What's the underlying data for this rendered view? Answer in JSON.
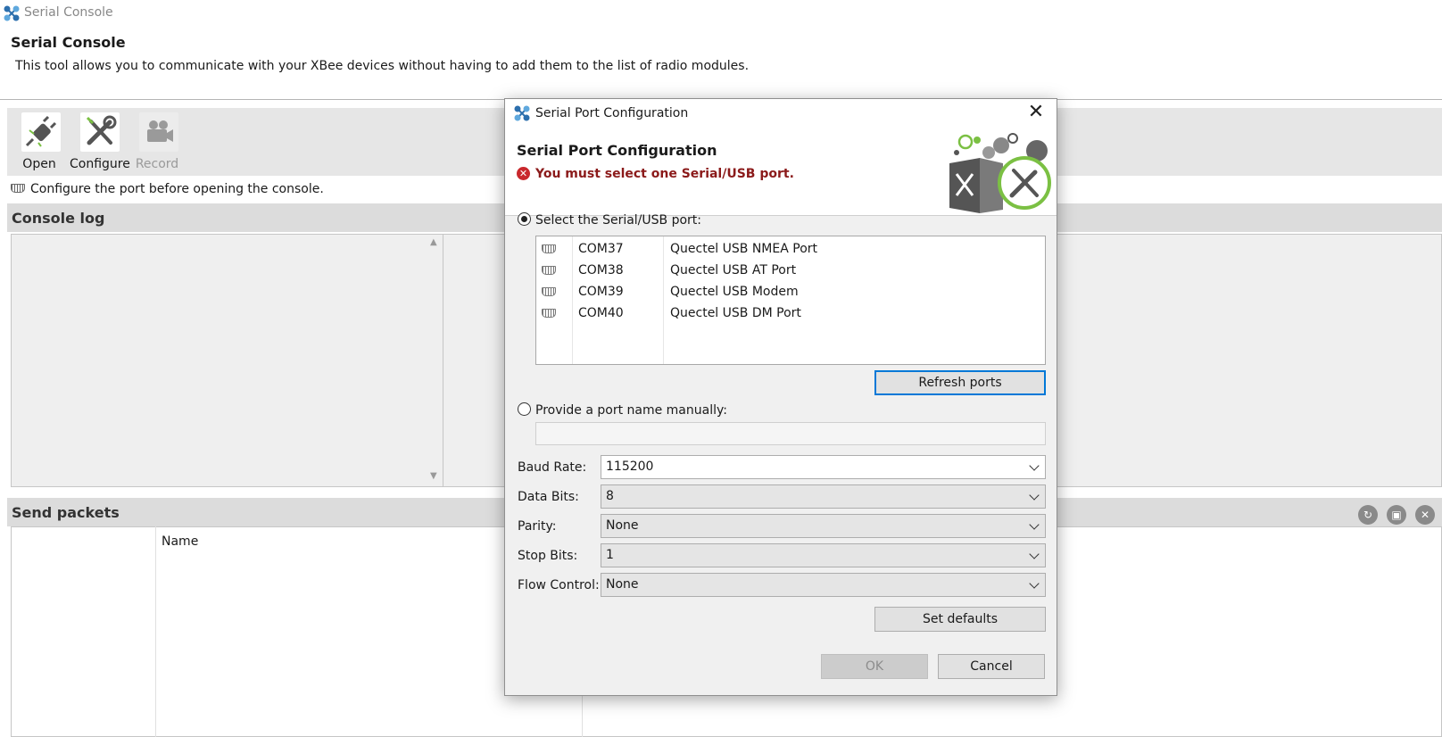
{
  "app": {
    "window_title": "Serial Console",
    "header_title": "Serial Console",
    "header_description": "This tool allows you to communicate with your XBee devices without having to add them to the list of radio modules.",
    "toolbar": {
      "open_label": "Open",
      "configure_label": "Configure",
      "record_label": "Record"
    },
    "status_message": "Configure the port before opening the console.",
    "console_log_title": "Console log",
    "send_packets_title": "Send packets",
    "send_packets_column": "Name"
  },
  "dialog": {
    "window_title": "Serial Port Configuration",
    "heading": "Serial Port Configuration",
    "error_message": "You must select one Serial/USB port.",
    "select_port_label": "Select the Serial/USB port:",
    "ports": [
      {
        "port": "COM37",
        "description": "Quectel USB NMEA Port"
      },
      {
        "port": "COM38",
        "description": "Quectel USB AT Port"
      },
      {
        "port": "COM39",
        "description": "Quectel USB Modem"
      },
      {
        "port": "COM40",
        "description": "Quectel USB DM Port"
      }
    ],
    "refresh_button": "Refresh ports",
    "manual_port_label": "Provide a port name manually:",
    "manual_port_value": "",
    "fields": {
      "baud_rate": {
        "label": "Baud Rate:",
        "value": "115200"
      },
      "data_bits": {
        "label": "Data Bits:",
        "value": "8"
      },
      "parity": {
        "label": "Parity:",
        "value": "None"
      },
      "stop_bits": {
        "label": "Stop Bits:",
        "value": "1"
      },
      "flow_control": {
        "label": "Flow Control:",
        "value": "None"
      }
    },
    "set_defaults_button": "Set defaults",
    "ok_button": "OK",
    "cancel_button": "Cancel"
  },
  "colors": {
    "accent": "#0078d7",
    "error": "#8b1a1a",
    "green": "#7bc043"
  }
}
